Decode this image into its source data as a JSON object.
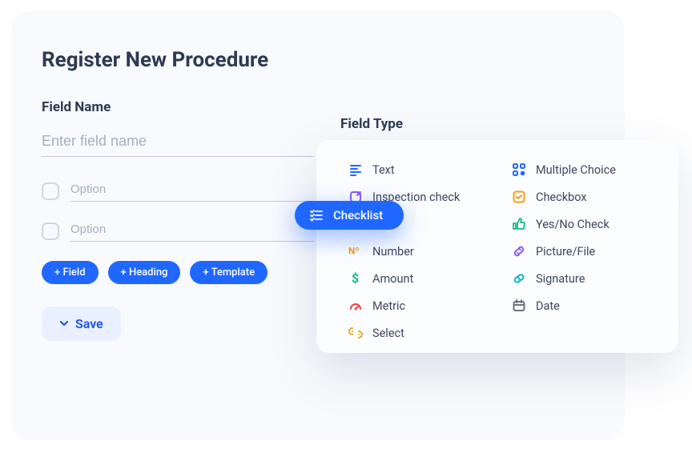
{
  "title": "Register New Procedure",
  "left": {
    "field_name_label": "Field Name",
    "field_name_placeholder": "Enter field name",
    "option1_placeholder": "Option",
    "option2_placeholder": "Option",
    "add_field": "+ Field",
    "add_heading": "+ Heading",
    "add_template": "+ Template",
    "save": "Save"
  },
  "right": {
    "field_type_label": "Field Type"
  },
  "types": {
    "text": "Text",
    "inspection": "Inspection check",
    "checklist": "Checklist",
    "number": "Number",
    "amount": "Amount",
    "metric": "Metric",
    "select": "Select",
    "multiple": "Multiple Choice",
    "checkbox": "Checkbox",
    "yesno": "Yes/No Check",
    "picture": "Picture/File",
    "signature": "Signature",
    "date": "Date"
  }
}
